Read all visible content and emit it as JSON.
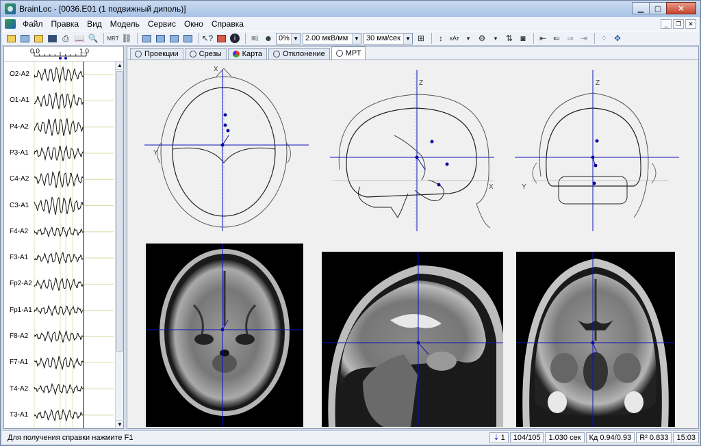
{
  "window": {
    "title": "BrainLoc - [0036.E01 (1 подвижный диполь)]"
  },
  "menu": {
    "items": [
      "Файл",
      "Правка",
      "Вид",
      "Модель",
      "Сервис",
      "Окно",
      "Справка"
    ]
  },
  "toolbar": {
    "percent_select": "0%",
    "amplitude_select": "2.00 мкВ/мм",
    "speed_select": "30 мм/сек"
  },
  "eeg": {
    "ruler_start": "0.0",
    "ruler_end": "1.0",
    "channels": [
      "O2-A2",
      "O1-A1",
      "P4-A2",
      "P3-A1",
      "C4-A2",
      "C3-A1",
      "F4-A2",
      "F3-A1",
      "Fp2-A2",
      "Fp1-A1",
      "F8-A2",
      "F7-A1",
      "T4-A2",
      "T3-A1"
    ]
  },
  "tabs": [
    {
      "label": "Проекции",
      "active": false
    },
    {
      "label": "Срезы",
      "active": false
    },
    {
      "label": "Карта",
      "active": false
    },
    {
      "label": "Отклонение",
      "active": false
    },
    {
      "label": "МРТ",
      "active": true
    }
  ],
  "views": {
    "axis_x": "X",
    "axis_y": "Y",
    "axis_z": "Z"
  },
  "status": {
    "help": "Для получения справки нажмите F1",
    "dipole": "1",
    "position": "104/105",
    "time": "1.030 сек",
    "kd": "Кд 0.94/0.93",
    "r2": "R² 0.833",
    "clock": "15:03"
  },
  "colors": {
    "crosshair": "#1010c0",
    "dipole": "#0a0a9a"
  }
}
